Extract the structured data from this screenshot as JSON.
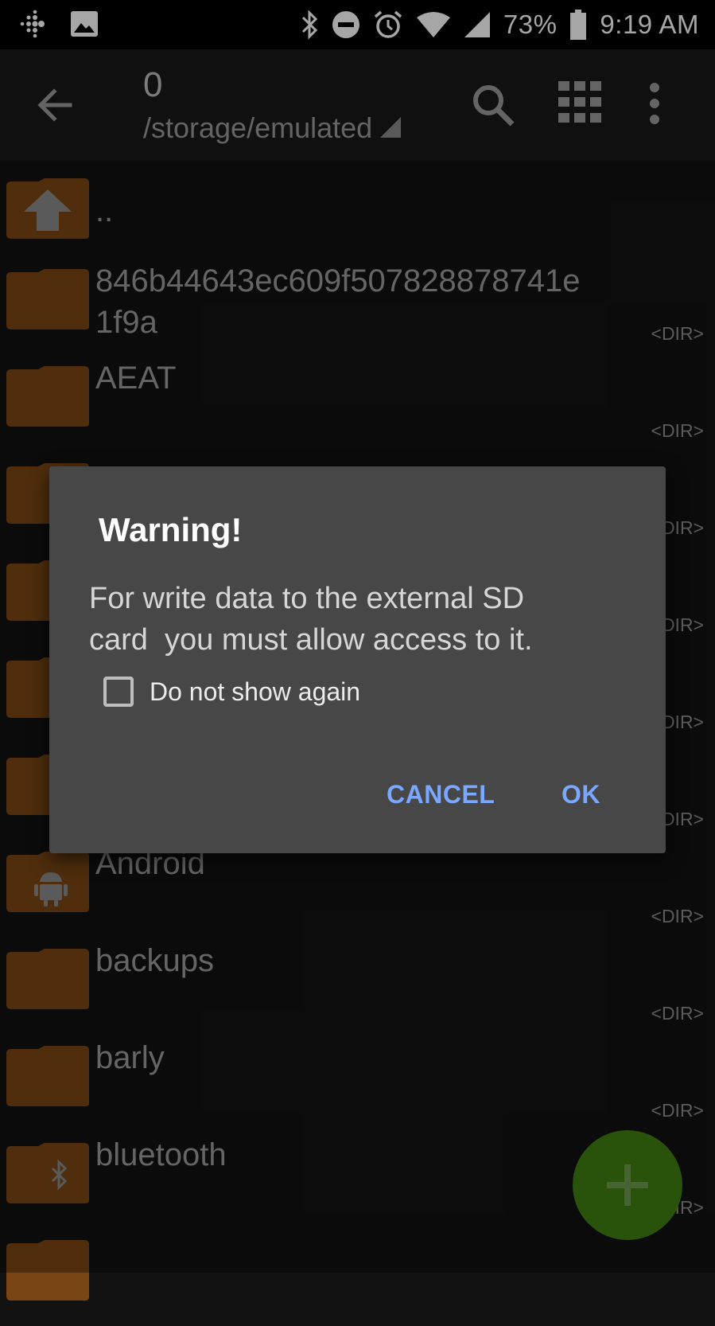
{
  "status_bar": {
    "battery": "73%",
    "time": "9:19 AM",
    "icons": [
      "fitbit-icon",
      "image-icon",
      "bluetooth-icon",
      "do-not-disturb-icon",
      "alarm-icon",
      "wifi-icon",
      "signal-icon",
      "battery-icon"
    ]
  },
  "toolbar": {
    "count": "0",
    "path": "/storage/emulated",
    "icons": [
      "back-arrow-icon",
      "search-icon",
      "grid-view-icon",
      "more-vert-icon"
    ]
  },
  "files": [
    {
      "name": "..",
      "dir": ""
    },
    {
      "name": "846b44643ec609f507828878741e",
      "name2": "1f9a",
      "dir": "<DIR>"
    },
    {
      "name": "AEAT",
      "dir": "<DIR>"
    },
    {
      "name": "",
      "dir": "<DIR>"
    },
    {
      "name": "",
      "dir": "<DIR>"
    },
    {
      "name": "",
      "dir": "<DIR>"
    },
    {
      "name": "",
      "dir": "<DIR>"
    },
    {
      "name": "Android",
      "dir": "<DIR>"
    },
    {
      "name": "backups",
      "dir": "<DIR>"
    },
    {
      "name": "barly",
      "dir": "<DIR>"
    },
    {
      "name": "bluetooth",
      "dir": "<DIR>"
    }
  ],
  "dialog": {
    "title": "Warning!",
    "message_line1": "For write data to the external SD",
    "message_line2": "card  you must allow access to it.",
    "checkbox_label": "Do not show again",
    "cancel": "CANCEL",
    "ok": "OK"
  },
  "colors": {
    "folder": "#7a4515",
    "accent": "#7aa7ff",
    "fab": "#3f7e12"
  }
}
